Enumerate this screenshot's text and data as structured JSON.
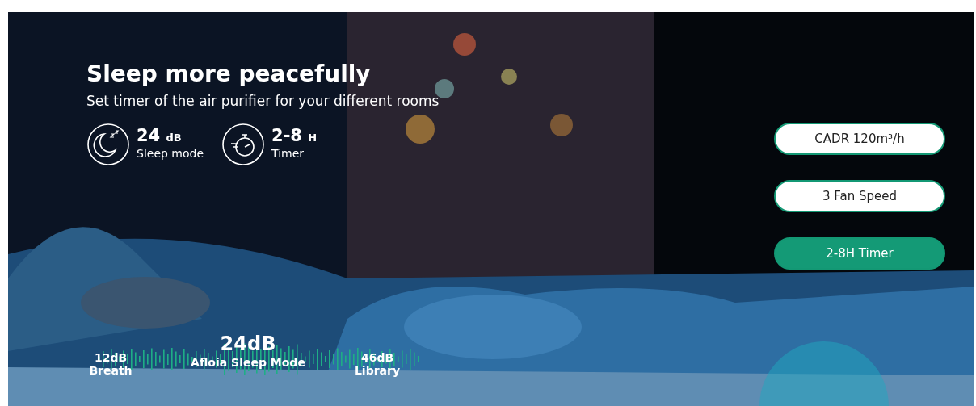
{
  "banner": {
    "title": "Sleep more peacefully",
    "subtitle": "Set timer of the air purifier for your different rooms",
    "features": [
      {
        "kind": "sleep",
        "value": "24",
        "unit": "dB",
        "label": "Sleep mode"
      },
      {
        "kind": "timer",
        "value": "2-8",
        "unit": "H",
        "label": "Timer"
      }
    ],
    "options": [
      {
        "label": "CADR 120m³/h",
        "selected": false
      },
      {
        "label": "3 Fan Speed",
        "selected": false
      },
      {
        "label": "2-8H Timer",
        "selected": true
      }
    ],
    "noise_levels": [
      {
        "kind": "minor",
        "value": "12dB",
        "label": "Breath"
      },
      {
        "kind": "main",
        "value": "24dB",
        "label": "Afloia Sleep Mode"
      },
      {
        "kind": "minor",
        "value": "46dB",
        "label": "Library"
      }
    ]
  }
}
